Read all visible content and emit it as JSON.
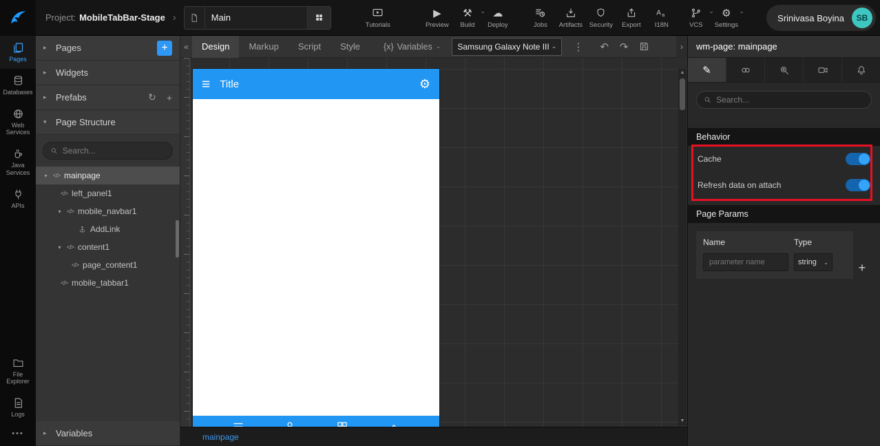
{
  "colors": {
    "accent_blue": "#2196f3",
    "annotation_red": "#e81123",
    "avatar_teal": "#3ec6c0",
    "link_blue": "#3d9af0"
  },
  "icons": {
    "caret_down": "▾",
    "caret_right": "▸",
    "chevron_down": "⌄",
    "chevron_right": "›",
    "collapse_left": "«",
    "plus": "+",
    "refresh": "↻",
    "gear": "⚙",
    "play": "▶",
    "hamburger": "≡",
    "undo": "↶",
    "redo": "↷",
    "dots_vertical": "⋮",
    "dots_more": "•••",
    "build": "⚒",
    "cloud": "☁",
    "pencil": "✎",
    "code": "</>",
    "tri_up": "▲",
    "tri_down": "▼"
  },
  "topbar": {
    "project_label": "Project:",
    "project_name": "MobileTabBar-Stage",
    "page_name": "Main",
    "actions": [
      {
        "label": "Tutorials"
      },
      {
        "label": "Preview"
      },
      {
        "label": "Build"
      },
      {
        "label": "Deploy"
      },
      {
        "label": "Jobs"
      },
      {
        "label": "Artifacts"
      },
      {
        "label": "Security"
      },
      {
        "label": "Export"
      },
      {
        "label": "I18N"
      },
      {
        "label": "VCS"
      },
      {
        "label": "Settings"
      }
    ],
    "user": {
      "name": "Srinivasa Boyina",
      "initials": "SB"
    }
  },
  "rail": {
    "items": [
      {
        "label": "Pages"
      },
      {
        "label": "Databases"
      },
      {
        "label": "Web Services"
      },
      {
        "label": "Java Services"
      },
      {
        "label": "APIs"
      },
      {
        "label": "File Explorer"
      },
      {
        "label": "Logs"
      }
    ]
  },
  "left_panel": {
    "pages_label": "Pages",
    "widgets_label": "Widgets",
    "prefabs_label": "Prefabs",
    "page_structure_label": "Page Structure",
    "variables_label": "Variables",
    "search_placeholder": "Search...",
    "tree": [
      {
        "label": "mainpage"
      },
      {
        "label": "left_panel1"
      },
      {
        "label": "mobile_navbar1"
      },
      {
        "label": "AddLink"
      },
      {
        "label": "content1"
      },
      {
        "label": "page_content1"
      },
      {
        "label": "mobile_tabbar1"
      }
    ]
  },
  "canvas": {
    "tabs": [
      {
        "label": "Design"
      },
      {
        "label": "Markup"
      },
      {
        "label": "Script"
      },
      {
        "label": "Style"
      }
    ],
    "variables_prefix": "{x}",
    "variables_label": "Variables",
    "device_select": "Samsung Galaxy Note III",
    "bottom_tab": "mainpage",
    "phone_title": "Title"
  },
  "right_panel": {
    "title": "wm-page: mainpage",
    "search_placeholder": "Search...",
    "behavior": {
      "label": "Behavior",
      "cache_label": "Cache",
      "cache_on": true,
      "refresh_label": "Refresh data on attach",
      "refresh_on": true
    },
    "page_params": {
      "label": "Page Params",
      "name_col": "Name",
      "type_col": "Type",
      "param_placeholder": "parameter name",
      "type_value": "string"
    }
  }
}
